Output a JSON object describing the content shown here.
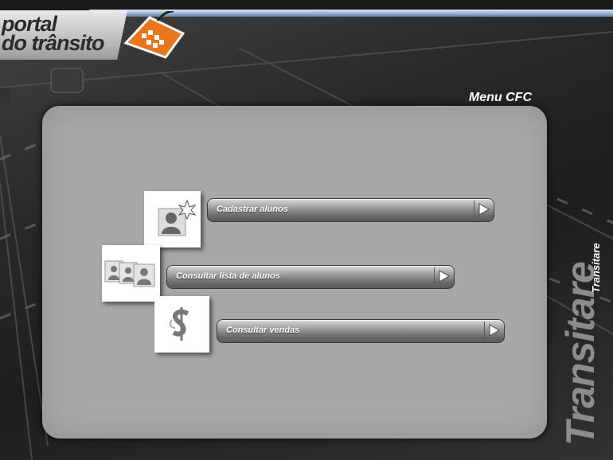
{
  "logo": {
    "line1": "portal",
    "line2": "do trânsito"
  },
  "page": {
    "title": "Menu CFC"
  },
  "menu": {
    "items": [
      {
        "label": "Cadastrar alunos",
        "icon": "user-add-icon"
      },
      {
        "label": "Consultar lista de alunos",
        "icon": "user-list-icon"
      },
      {
        "label": "Consultar vendas",
        "icon": "money-sign-icon"
      }
    ]
  },
  "brand": {
    "big": "Transitare",
    "small": "Transitare"
  },
  "colors": {
    "logo_orange": "#e8761d",
    "panel": "#a7a7a7",
    "accent_blue": "#9fb8d3"
  }
}
